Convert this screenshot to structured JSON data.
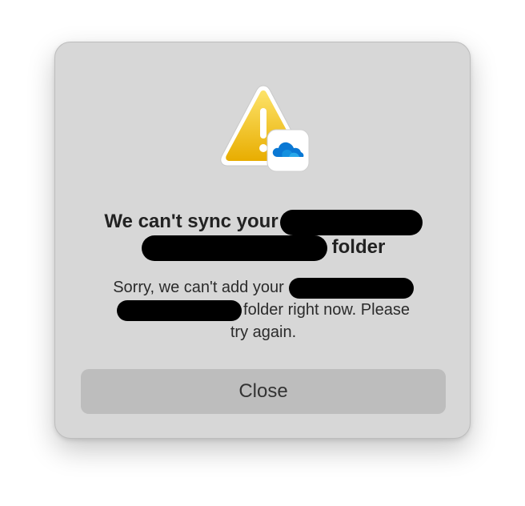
{
  "dialog": {
    "title_line1": "We can't sync your",
    "title_line2_suffix": "folder",
    "message_line1": "Sorry, we can't add your",
    "message_line2_suffix": "folder right now. Please",
    "message_line3": "try again.",
    "close_label": "Close"
  },
  "icons": {
    "warning": "warning-triangle-icon",
    "app": "onedrive-cloud-icon"
  },
  "colors": {
    "dialog_background": "#d7d7d7",
    "button_background": "#bdbdbd",
    "warning_yellow": "#f2c200",
    "onedrive_blue": "#0a78d4"
  }
}
